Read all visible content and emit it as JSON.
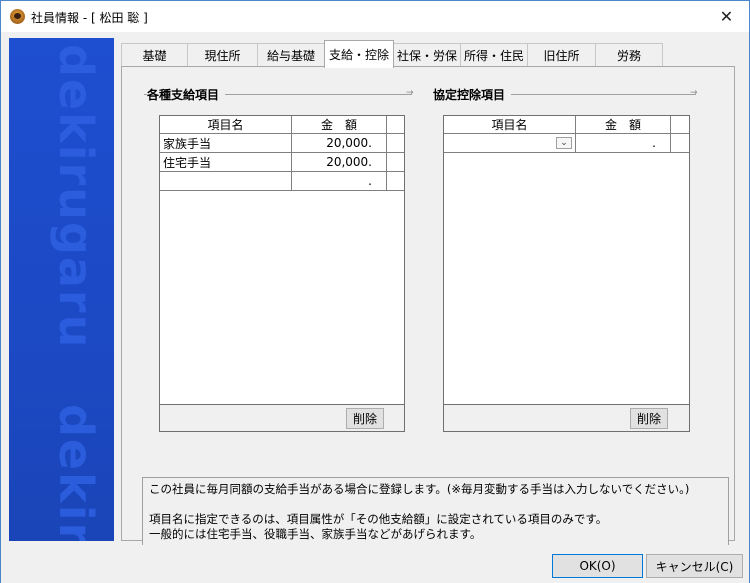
{
  "window": {
    "title": "社員情報 - [ 松田 聡 ]",
    "close_glyph": "✕"
  },
  "brand": {
    "top_text": "dekirugaru",
    "bottom_text": "dekiru"
  },
  "tabs": [
    {
      "label": "基礎"
    },
    {
      "label": "現住所"
    },
    {
      "label": "給与基礎"
    },
    {
      "label": "支給・控除"
    },
    {
      "label": "社保・労保"
    },
    {
      "label": "所得・住民"
    },
    {
      "label": "旧住所"
    },
    {
      "label": "労務"
    }
  ],
  "allowances": {
    "title": "各種支給項目",
    "columns": [
      "項目名",
      "金　額"
    ],
    "rows": [
      {
        "name": "家族手当",
        "amount": "20,000."
      },
      {
        "name": "住宅手当",
        "amount": "20,000."
      },
      {
        "name": "",
        "amount": "."
      }
    ],
    "delete_label": "削除"
  },
  "deductions": {
    "title": "協定控除項目",
    "columns": [
      "項目名",
      "金　額"
    ],
    "rows": [
      {
        "name": "",
        "amount": "."
      }
    ],
    "delete_label": "削除"
  },
  "note": {
    "line1": "この社員に毎月同額の支給手当がある場合に登録します。(※毎月変動する手当は入力しないでください。)",
    "line2": "項目名に指定できるのは、項目属性が「その他支給額」に設定されている項目のみです。",
    "line3": "一般的には住宅手当、役職手当、家族手当などがあげられます。"
  },
  "footer": {
    "ok_label": "OK(O)",
    "cancel_label": "キャンセル(C)"
  },
  "colors": {
    "brand_blue": "#1e4fd0",
    "window_border": "#4a86c8"
  }
}
